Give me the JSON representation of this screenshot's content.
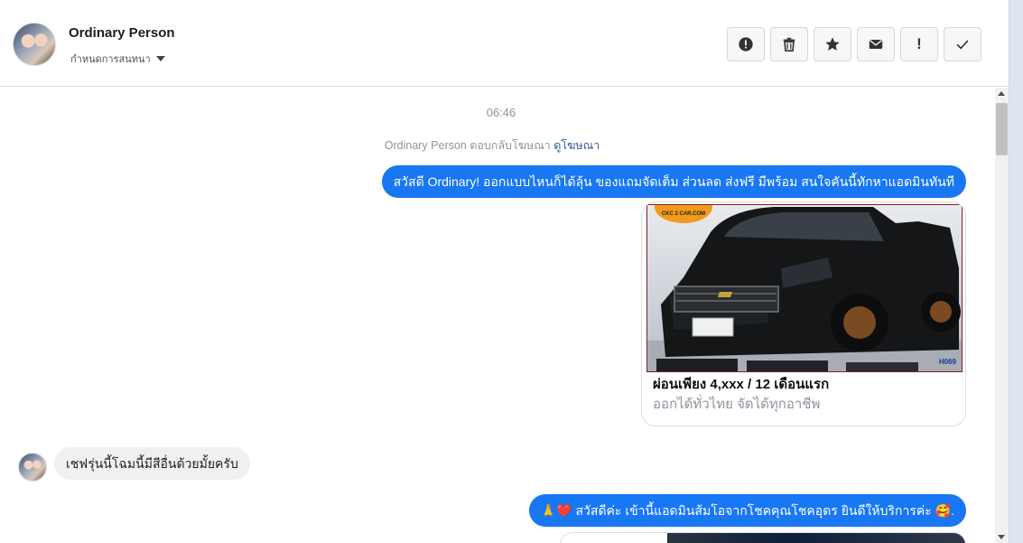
{
  "header": {
    "contact_name": "Ordinary Person",
    "assign_label": "กำหนดการสนทนา",
    "toolbar": {
      "spam_icon": "alert-circle-icon",
      "delete_icon": "trash-icon",
      "star_icon": "star-icon",
      "unread_icon": "envelope-icon",
      "follow_up_text": "!",
      "done_icon": "checkmark-icon"
    }
  },
  "conversation": {
    "timestamp": "06:46",
    "ad_reply": {
      "name": "Ordinary Person",
      "text": " ตอบกลับโฆษณา ",
      "link": "ดูโฆษณา"
    },
    "messages": [
      {
        "direction": "outgoing",
        "text": "สวัสดี Ordinary! ออกแบบไหนก็ได้ลุ้น ของแถมจัดเต็ม ส่วนลด ส่งฟรี มีพร้อม สนใจคันนี้ทักหาแอดมินทันที"
      },
      {
        "direction": "outgoing",
        "type": "card",
        "image_logo_text": "CKC 2 CAR.COM",
        "image_code": "H069",
        "title": "ผ่อนเพียง 4,xxx / 12 เดือนแรก",
        "subtitle": "ออกได้ทั่วไทย จัดได้ทุกอาชีพ"
      },
      {
        "direction": "incoming",
        "text": "เชฟรุ่นนี้โฉมนี้มีสีอื่นด้วยมั้ยครับ"
      },
      {
        "direction": "outgoing",
        "text": "🙏❤️ สวัสดีค่ะ เข้านี้แอดมินส้มโอจากโชคคุณโชคอุดร ยินดีให้บริการค่ะ 🥰."
      }
    ]
  },
  "colors": {
    "outgoing_bubble": "#1877f2",
    "incoming_bubble": "#f0f0f0",
    "link": "#385898"
  }
}
